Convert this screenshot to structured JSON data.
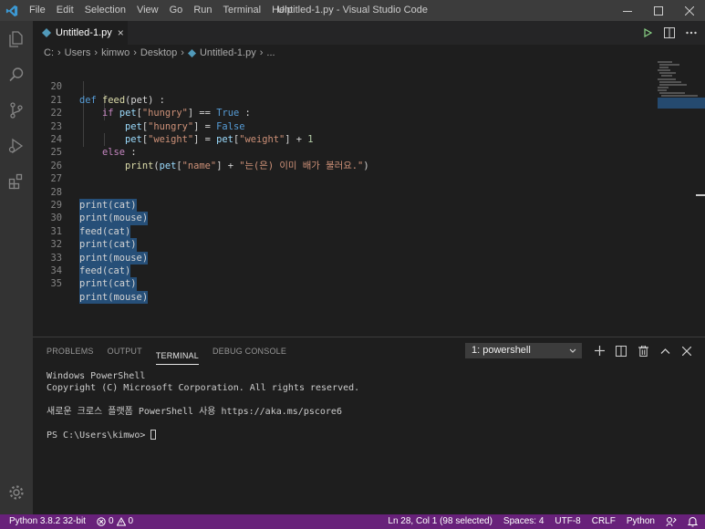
{
  "titlebar": {
    "menu": [
      "File",
      "Edit",
      "Selection",
      "View",
      "Go",
      "Run",
      "Terminal",
      "Help"
    ],
    "title": "Untitled-1.py - Visual Studio Code"
  },
  "tab": {
    "label": "Untitled-1.py",
    "close": "×"
  },
  "breadcrumb": {
    "parts": [
      "C:",
      "Users",
      "kimwo",
      "Desktop"
    ],
    "file": "Untitled-1.py",
    "more": "..."
  },
  "editor": {
    "lines": [
      {
        "n": "20"
      },
      {
        "n": "21"
      },
      {
        "n": "22"
      },
      {
        "n": "23"
      },
      {
        "n": "24"
      },
      {
        "n": "25"
      },
      {
        "n": "26"
      },
      {
        "n": "27"
      },
      {
        "n": "28"
      },
      {
        "n": "29"
      },
      {
        "n": "30"
      },
      {
        "n": "31"
      },
      {
        "n": "32"
      },
      {
        "n": "33"
      },
      {
        "n": "34"
      },
      {
        "n": "35"
      }
    ],
    "code": {
      "l20": {
        "kw": "def",
        "fn": "feed",
        "rest": "(pet) :"
      },
      "l21": {
        "kw": "if",
        "var": "pet",
        "s1": "\"hungry\"",
        "op": "] == ",
        "const": "True",
        "end": " :"
      },
      "l22": {
        "var": "pet",
        "s1": "\"hungry\"",
        "op": "] = ",
        "const": "False"
      },
      "l23": {
        "var": "pet",
        "s1": "\"weight\"",
        "op": "] = ",
        "var2": "pet",
        "s2": "\"weight\"",
        "op2": "] + ",
        "num": "1"
      },
      "l24": {
        "kw": "else",
        "end": " :"
      },
      "l25": {
        "fn": "print",
        "var": "pet",
        "s1": "\"name\"",
        "op": "] + ",
        "s2": "\"는(은) 이미 배가 불러요.\"",
        "end": ")"
      },
      "sel": [
        "print(cat)",
        "print(mouse)",
        "feed(cat)",
        "print(cat)",
        "print(mouse)",
        "feed(cat)",
        "print(cat)",
        "print(mouse)"
      ]
    }
  },
  "panel": {
    "tabs": [
      "PROBLEMS",
      "OUTPUT",
      "TERMINAL",
      "DEBUG CONSOLE"
    ],
    "active_tab": "TERMINAL",
    "terminal_select": "1: powershell",
    "terminal_lines": [
      "Windows PowerShell",
      "Copyright (C) Microsoft Corporation. All rights reserved.",
      "",
      "새로운 크로스 플랫폼 PowerShell 사용 https://aka.ms/pscore6",
      ""
    ],
    "prompt": "PS C:\\Users\\kimwo> "
  },
  "statusbar": {
    "python": "Python 3.8.2 32-bit",
    "errors": "0",
    "warnings": "0",
    "position": "Ln 28, Col 1 (98 selected)",
    "spaces": "Spaces: 4",
    "encoding": "UTF-8",
    "eol": "CRLF",
    "language": "Python"
  },
  "colors": {
    "statusbar": "#68217a",
    "selection": "#264f78",
    "titlebar": "#3c3c3c",
    "activitybar": "#333333"
  }
}
